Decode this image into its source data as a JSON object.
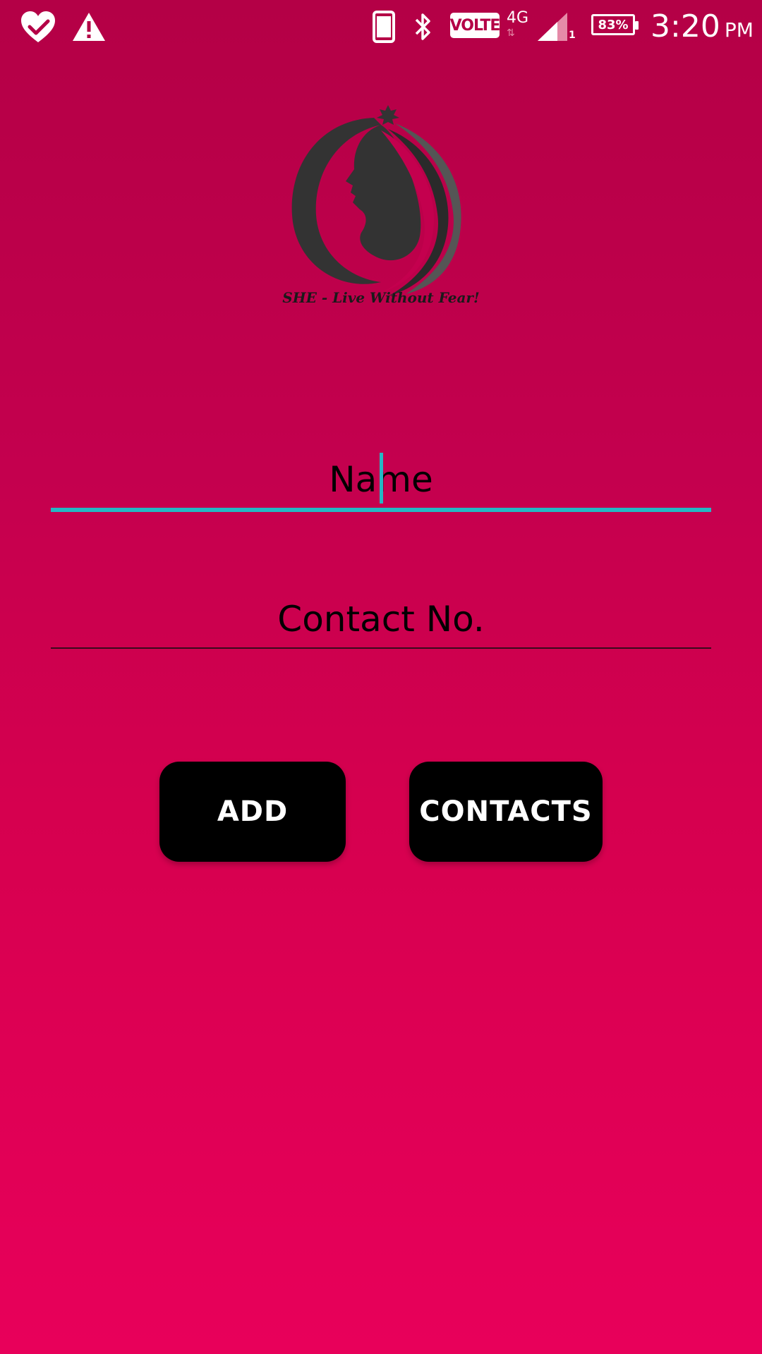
{
  "status_bar": {
    "time": "3:20",
    "ampm": "PM",
    "volte": "VOLTE",
    "network_type": "4G",
    "sim_slot": "1",
    "battery_percent": "83%",
    "icons": [
      "heart-check-icon",
      "warning-icon",
      "phone-icon",
      "bluetooth-icon",
      "signal-icon",
      "battery-icon"
    ]
  },
  "logo": {
    "tagline": "SHE - Live Without Fear!"
  },
  "form": {
    "name_placeholder": "Name",
    "name_value": "",
    "contact_placeholder": "Contact No.",
    "contact_value": ""
  },
  "buttons": {
    "add_label": "ADD",
    "contacts_label": "CONTACTS"
  },
  "colors": {
    "background_top": "#b40046",
    "background_bottom": "#e8005a",
    "focus_accent": "#25b8c4",
    "button_bg": "#000000",
    "button_text": "#ffffff"
  }
}
